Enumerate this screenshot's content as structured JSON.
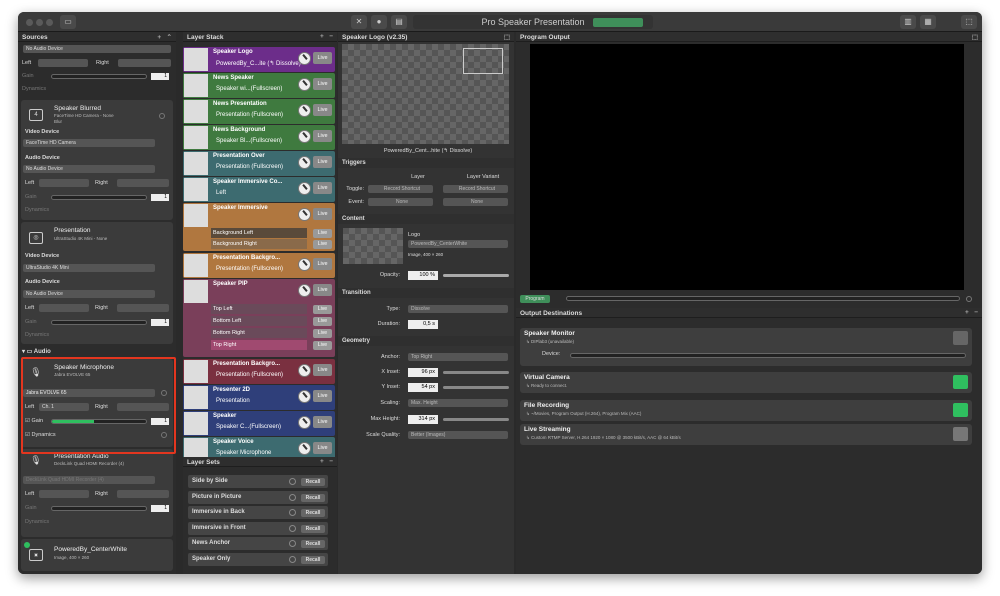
{
  "window": {
    "title": "Pro Speaker Presentation"
  },
  "sources": {
    "header": "Sources",
    "add": "+",
    "remove": "-",
    "top": {
      "audio_device": "No Audio Device",
      "left": "Left",
      "right": "Right",
      "gain": "Gain",
      "gain_value": "1",
      "dynamics": "Dynamics"
    },
    "speaker_blurred": {
      "name": "Speaker Blurred",
      "sub1": "FaceTime HD Camera - None",
      "sub2": "Blur",
      "video_label": "Video Device",
      "video_value": "FaceTime HD Camera",
      "audio_label": "Audio Device",
      "audio_value": "No Audio Device",
      "left": "Left",
      "right": "Right",
      "gain": "Gain",
      "gain_value": "1",
      "dynamics": "Dynamics"
    },
    "presentation": {
      "name": "Presentation",
      "sub": "UltraStudio 4K Mini - None",
      "video_label": "Video Device",
      "video_value": "UltraStudio 4K Mini",
      "audio_label": "Audio Device",
      "audio_value": "No Audio Device",
      "left": "Left",
      "right": "Right",
      "gain": "Gain",
      "gain_value": "1",
      "dynamics": "Dynamics"
    },
    "audio_group": "Audio",
    "speaker_mic": {
      "name": "Speaker Microphone",
      "sub": "Jabra EVOLVE 65",
      "device": "Jabra EVOLVE 65",
      "left": "Left",
      "channel": "Ch. 1",
      "right": "Right",
      "gain": "Gain",
      "gain_value": "1",
      "gain_level": 0.45,
      "dynamics": "Dynamics"
    },
    "presentation_audio": {
      "name": "Presentation Audio",
      "sub": "DeckLink Quad HDMI Recorder (4)",
      "device": "DeckLink Quad HDMI Recorder (4)",
      "left": "Left",
      "right": "Right",
      "gain": "Gain",
      "gain_value": "1",
      "dynamics": "Dynamics"
    },
    "powered_by": {
      "name": "PoweredBy_CenterWhite",
      "sub": "Image, 400 × 260"
    }
  },
  "layers": {
    "header": "Layer Stack",
    "add": "+",
    "remove": "-",
    "live": "Live",
    "items": [
      {
        "title": "Speaker Logo",
        "sub": "PoweredBy_C...ite (↰ Dissolve)",
        "color": "#6c2d8a"
      },
      {
        "title": "News Speaker",
        "sub": "Speaker wi...(Fullscreen)",
        "color": "#3f7a3f"
      },
      {
        "title": "News Presentation",
        "sub": "Presentation (Fullscreen)",
        "color": "#3f7a3f"
      },
      {
        "title": "News Background",
        "sub": "Speaker Bl...(Fullscreen)",
        "color": "#3f7a3f"
      },
      {
        "title": "Presentation Over",
        "sub": "Presentation (Fullscreen)",
        "color": "#3d6b70"
      },
      {
        "title": "Speaker Immersive Co...",
        "sub": "Left",
        "color": "#3d6b70"
      },
      {
        "title": "Speaker Immersive",
        "sub": "",
        "color": "#b0773f"
      },
      {
        "title": "Presentation Backgro...",
        "sub": "Presentation (Fullscreen)",
        "color": "#b0773f"
      },
      {
        "title": "Speaker PIP",
        "sub": "",
        "color": "#7a3f5a"
      },
      {
        "title": "Presentation Backgro...",
        "sub": "Presentation (Fullscreen)",
        "color": "#7a3040"
      },
      {
        "title": "Presenter 2D",
        "sub": "Presentation",
        "color": "#2f3f7a"
      },
      {
        "title": "Speaker",
        "sub": "Speaker C...(Fullscreen)",
        "color": "#2f3f7a"
      },
      {
        "title": "Speaker Voice",
        "sub": "Speaker Microphone",
        "color": "#3d6b70"
      }
    ],
    "immersive_variants": [
      "Background Left",
      "Background Right"
    ],
    "pip_variants": [
      "Top Left",
      "Bottom Left",
      "Bottom Right",
      "Top Right"
    ],
    "sets_header": "Layer Sets",
    "sets": [
      "Side by Side",
      "Picture in Picture",
      "Immersive in Back",
      "Immersive in Front",
      "News Anchor",
      "Speaker Only"
    ],
    "recall": "Recall"
  },
  "inspector": {
    "header": "Speaker Logo (v2.35)",
    "preview_caption": "PoweredBy_Cent...hite (↰ Dissolve)",
    "triggers": "Triggers",
    "layer": "Layer",
    "layer_variant": "Layer Variant",
    "toggle": "Toggle:",
    "record_shortcut": "Record Shortcut",
    "event": "Event:",
    "none": "None",
    "content": "Content",
    "logo": "Logo",
    "logo_value": "PoweredBy_CenterWhite",
    "logo_info": "Image, 400 × 260",
    "opacity": "Opacity:",
    "opacity_value": "100 %",
    "opacity_level": 1.0,
    "transition": "Transition",
    "type": "Type:",
    "type_value": "Dissolve",
    "duration": "Duration:",
    "duration_value": "0,5 s",
    "geometry": "Geometry",
    "anchor": "Anchor:",
    "anchor_value": "Top Right",
    "x_inset": "X Inset:",
    "x_value": "96 px",
    "y_inset": "Y Inset:",
    "y_value": "54 px",
    "scaling": "Scaling:",
    "scaling_value": "Max. Height",
    "max_height": "Max Height:",
    "max_value": "314 px",
    "scale_quality": "Scale Quality:",
    "quality_value": "Better (Images)"
  },
  "program": {
    "header": "Program Output",
    "program_btn": "Program",
    "dest_header": "Output Destinations",
    "destinations": [
      {
        "name": "Speaker Monitor",
        "sub": "↳ DIPlab3 (unavailable)",
        "device_label": "Device:",
        "color": "#666"
      },
      {
        "name": "Virtual Camera",
        "sub": "↳ Ready to connect.",
        "color": "#2fbf5f"
      },
      {
        "name": "File Recording",
        "sub": "↳ ~/Movies, Program Output (H.264), Program Mix (AAC)",
        "color": "#2fbf5f"
      },
      {
        "name": "Live Streaming",
        "sub": "↳ Custom RTMP Server, H.264 1920 × 1080 @ 3500 kBit/s, AAC @ 64 kBit/s",
        "color": "#777"
      }
    ]
  }
}
